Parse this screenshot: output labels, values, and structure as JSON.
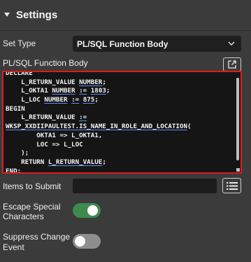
{
  "section": {
    "title": "Settings",
    "expanded": true
  },
  "set_type": {
    "label": "Set Type",
    "value": "PL/SQL Function Body"
  },
  "function_body": {
    "label": "PL/SQL Function Body",
    "lines": [
      [
        {
          "t": "DECLARE"
        }
      ],
      [
        {
          "t": "    L_RETURN_VALUE "
        },
        {
          "t": "NUMBER",
          "u": true
        },
        {
          "t": ";"
        }
      ],
      [
        {
          "t": "    L_OKTA1 "
        },
        {
          "t": "NUMBER",
          "u": true
        },
        {
          "t": " "
        },
        {
          "t": ":=",
          "u": true
        },
        {
          "t": " "
        },
        {
          "t": "1803",
          "u": true
        },
        {
          "t": ";"
        }
      ],
      [
        {
          "t": "    L_LOC "
        },
        {
          "t": "NUMBER",
          "u": true
        },
        {
          "t": " "
        },
        {
          "t": ":=",
          "u": true
        },
        {
          "t": " "
        },
        {
          "t": "875",
          "u": true
        },
        {
          "t": ";"
        }
      ],
      [
        {
          "t": "BEGIN"
        }
      ],
      [
        {
          "t": "    L_RETURN_VALUE "
        },
        {
          "t": ":=",
          "u": true
        }
      ],
      [
        {
          "t": "WKSP_XXDIIPAULTEST.IS_NAME_IN_ROLE_AND_LOCATION",
          "u": true
        },
        {
          "t": "("
        }
      ],
      [
        {
          "t": "        OKTA1 => L_OKTA1,"
        }
      ],
      [
        {
          "t": "        LOC => L_LOC"
        }
      ],
      [
        {
          "t": "    );"
        }
      ],
      [
        {
          "t": "    RETURN "
        },
        {
          "t": "L_RETURN_VALUE",
          "u": true
        },
        {
          "t": ";"
        }
      ],
      [
        {
          "t": "END;"
        }
      ]
    ]
  },
  "items_to_submit": {
    "label": "Items to Submit",
    "value": ""
  },
  "escape_special_characters": {
    "label_line1": "Escape Special",
    "label_line2": "Characters",
    "on": true
  },
  "suppress_change_event": {
    "label_line1": "Suppress Change",
    "label_line2": "Event",
    "on": false
  },
  "colors": {
    "background": "#3b3b3b",
    "editor_background": "#151515",
    "editor_focus_border": "#e01b1b",
    "toggle_on": "#3e8a4f",
    "toggle_off": "#8e8e8e"
  },
  "icons": {
    "section": "chevron-down-icon",
    "select": "chevron-down-icon",
    "expand": "expand-editor-icon",
    "list": "list-icon"
  }
}
